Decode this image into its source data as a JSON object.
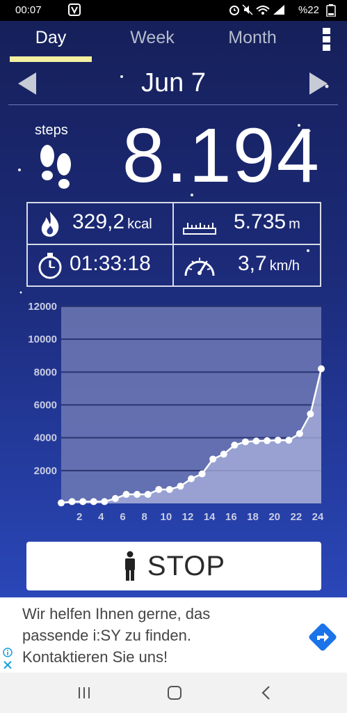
{
  "status_bar": {
    "time": "00:07",
    "battery": "%22",
    "icons": [
      "notification-icon",
      "alarm-icon",
      "mute-icon",
      "wifi-icon",
      "signal-icon",
      "battery-icon"
    ]
  },
  "tabs": [
    {
      "label": "Day",
      "active": true
    },
    {
      "label": "Week",
      "active": false
    },
    {
      "label": "Month",
      "active": false
    }
  ],
  "date": "Jun 7",
  "steps": {
    "label": "steps",
    "value": "8.194"
  },
  "stats": {
    "calories": {
      "value": "329,2",
      "unit": "kcal"
    },
    "distance": {
      "value": "5.735",
      "unit": "m"
    },
    "duration": {
      "value": "01:33:18"
    },
    "speed": {
      "value": "3,7",
      "unit": "km/h"
    }
  },
  "chart_data": {
    "type": "area",
    "x": [
      0,
      1,
      2,
      3,
      4,
      5,
      6,
      7,
      8,
      9,
      10,
      11,
      12,
      13,
      14,
      15,
      16,
      17,
      18,
      19,
      20,
      21,
      22,
      23,
      24
    ],
    "values": [
      30,
      110,
      110,
      110,
      110,
      300,
      550,
      550,
      550,
      850,
      850,
      1050,
      1500,
      1800,
      2700,
      3000,
      3550,
      3750,
      3800,
      3820,
      3850,
      3850,
      4250,
      5450,
      8200
    ],
    "ylim": [
      0,
      12000
    ],
    "yticks": [
      "12000",
      "10000",
      "8000",
      "6000",
      "4000",
      "2000"
    ],
    "yticks_values": [
      12000,
      10000,
      8000,
      6000,
      4000,
      2000
    ],
    "xticks": [
      "2",
      "4",
      "6",
      "8",
      "10",
      "12",
      "14",
      "16",
      "18",
      "20",
      "22",
      "24"
    ],
    "xticks_values": [
      2,
      4,
      6,
      8,
      10,
      12,
      14,
      16,
      18,
      20,
      22,
      24
    ],
    "xlim": [
      0,
      24
    ],
    "grid": true
  },
  "stop_button": {
    "label": "STOP"
  },
  "ad": {
    "text": "Wir helfen Ihnen gerne, das passende i:SY zu finden. Kontaktieren Sie uns!"
  },
  "colors": {
    "accent_underline": "#f3f0a0",
    "chart_fill": "#8a93c8",
    "ad_arrow": "#1a73e8"
  }
}
